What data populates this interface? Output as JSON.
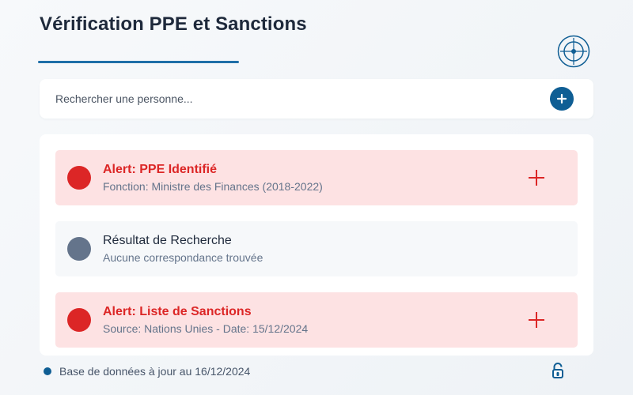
{
  "header": {
    "title": "Vérification PPE et Sanctions",
    "target_icon": "radar-target-icon"
  },
  "search": {
    "placeholder": "Rechercher une personne...",
    "value": "",
    "add_icon": "plus-circle-icon"
  },
  "results": [
    {
      "kind": "alert",
      "title": "Alert: PPE Identifié",
      "subtitle": "Fonction: Ministre des Finances (2018-2022)",
      "expand_icon": "plus-icon"
    },
    {
      "kind": "neutral",
      "title": "Résultat de Recherche",
      "subtitle": "Aucune correspondance trouvée"
    },
    {
      "kind": "alert",
      "title": "Alert: Liste de Sanctions",
      "subtitle": "Source: Nations Unies - Date: 15/12/2024",
      "expand_icon": "plus-icon"
    }
  ],
  "footer": {
    "status": "Base de données à jour au 16/12/2024",
    "status_icon": "status-dot-icon",
    "lock_icon": "lock-icon"
  },
  "colors": {
    "accent": "#0f5e94",
    "alert": "#dc2626",
    "alert_bg": "#fde2e3",
    "neutral": "#64748b"
  }
}
